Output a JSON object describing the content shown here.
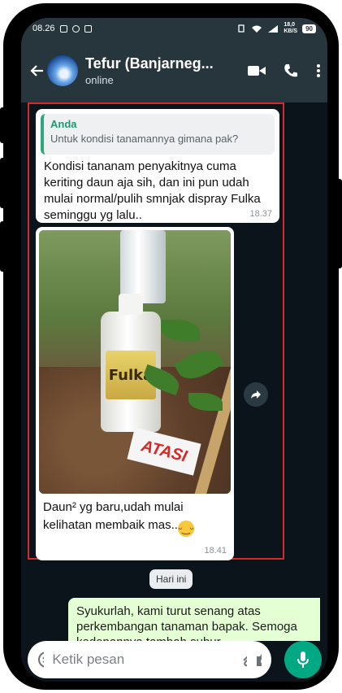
{
  "status_bar": {
    "time": "08.26",
    "speed_top": "18,0",
    "speed_bottom": "KB/S",
    "battery": "90"
  },
  "header": {
    "back_icon": "arrow-left-icon",
    "contact_name": "Tefur (Banjarneg...",
    "contact_status": "online"
  },
  "messages": {
    "m1": {
      "quote_author": "Anda",
      "quote_text": "Untuk kondisi tanamannya gimana pak?",
      "text": "Kondisi tananam penyakitnya cuma keriting daun aja sih, dan ini pun udah mulai normal/pulih smnjak dispray Fulka seminggu yg lalu..",
      "time": "18.37"
    },
    "m2": {
      "bottle_label": "Fulka",
      "sign_text": "ATASI",
      "caption": "Daun² yg baru,udah mulai kelihatan membaik mas..",
      "emoji": "😁",
      "time": "18.41"
    },
    "date_chip": "Hari ini",
    "m3": {
      "text": "Syukurlah, kami turut senang atas perkembangan tanaman bapak. Semoga kedepannya tambah subur"
    }
  },
  "input": {
    "placeholder": "Ketik pesan"
  },
  "colors": {
    "header": "#27353d",
    "chat_bg": "#0b141a",
    "accent": "#00a884",
    "highlight": "#d62a2a",
    "outgoing": "#e5ffd4"
  }
}
